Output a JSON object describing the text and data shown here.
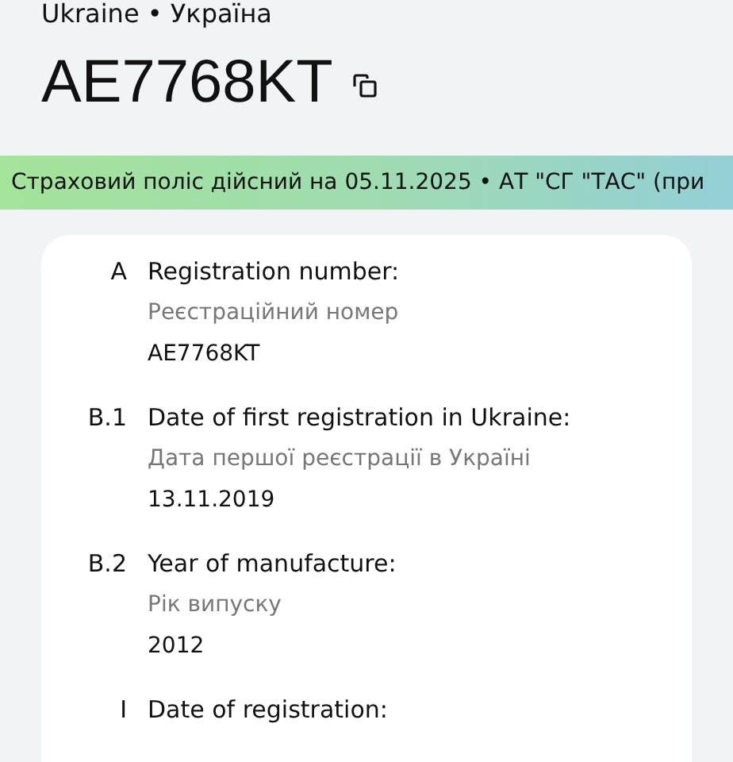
{
  "country": "Ukraine • Україна",
  "plate": "AE7768KT",
  "insurance_banner": "Страховий поліс дійсний на 05.11.2025 • АТ \"СГ \"ТАС\" (при",
  "fields": [
    {
      "code": "A",
      "label": "Registration number:",
      "label_uk": "Реєстраційний номер",
      "value": "AE7768KT"
    },
    {
      "code": "B.1",
      "label": "Date of first registration in Ukraine:",
      "label_uk": "Дата першої реєстрації в Україні",
      "value": "13.11.2019"
    },
    {
      "code": "B.2",
      "label": "Year of manufacture:",
      "label_uk": "Рік випуску",
      "value": "2012"
    },
    {
      "code": "I",
      "label": "Date of registration:"
    }
  ]
}
